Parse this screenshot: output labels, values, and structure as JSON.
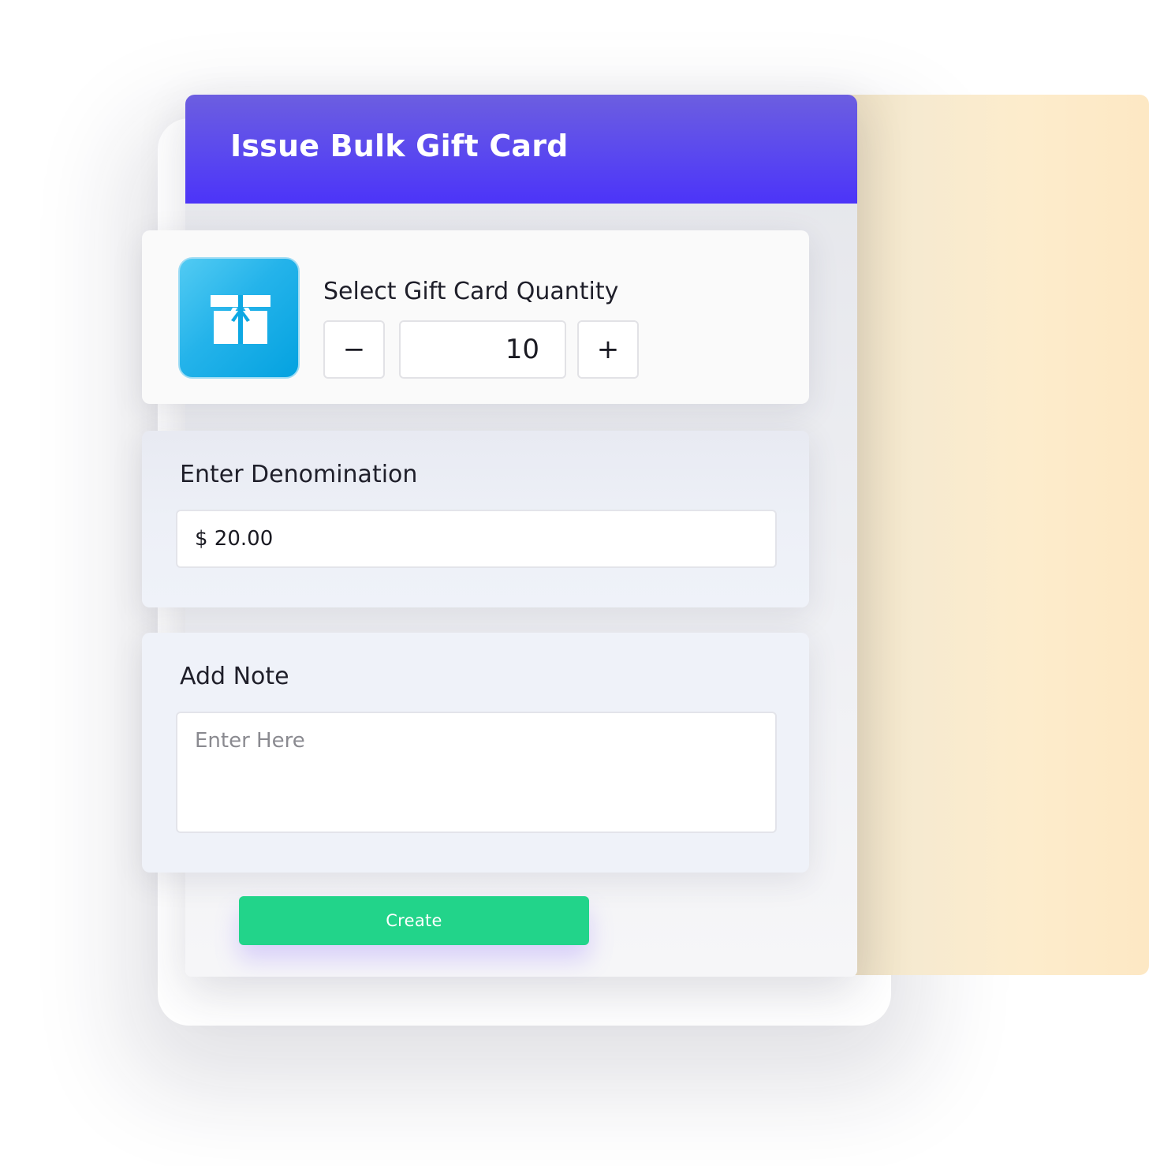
{
  "header": {
    "title": "Issue Bulk Gift Card"
  },
  "quantity": {
    "label": "Select Gift Card Quantity",
    "value": "10",
    "decrement_symbol": "−",
    "increment_symbol": "+",
    "icon": "gift-icon"
  },
  "denomination": {
    "label": "Enter Denomination",
    "value": "$ 20.00"
  },
  "note": {
    "label": "Add Note",
    "placeholder": "Enter Here",
    "value": ""
  },
  "actions": {
    "create_label": "Create"
  },
  "colors": {
    "header_gradient_top": "#6c5ee0",
    "header_gradient_bottom": "#4c34f8",
    "create_button": "#22d48a",
    "gift_tile": "#24b3ea",
    "backdrop": "#fdeccc"
  }
}
